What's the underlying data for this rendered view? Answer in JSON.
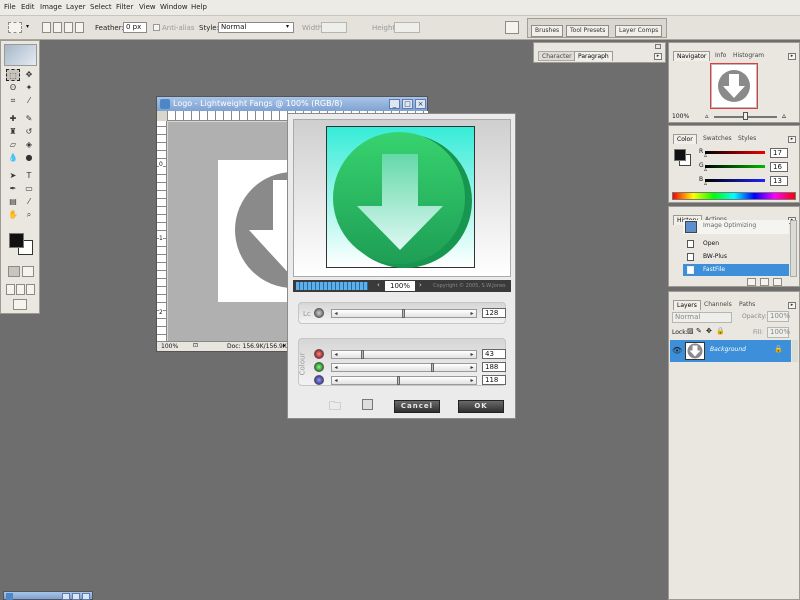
{
  "menu": [
    "File",
    "Edit",
    "Image",
    "Layer",
    "Select",
    "Filter",
    "View",
    "Window",
    "Help"
  ],
  "options": {
    "feather_label": "Feather:",
    "feather_value": "0 px",
    "antialias_label": "Anti-alias",
    "style_label": "Style:",
    "style_value": "Normal",
    "width_label": "Width:",
    "height_label": "Height:"
  },
  "well_tabs": [
    "Brushes",
    "Tool Presets",
    "Layer Comps"
  ],
  "char_panel": {
    "tabs": [
      "Character",
      "Paragraph"
    ]
  },
  "navigator": {
    "tabs": [
      "Navigator",
      "Info",
      "Histogram"
    ],
    "zoom": "100%"
  },
  "color": {
    "tabs": [
      "Color",
      "Swatches",
      "Styles"
    ],
    "r_label": "R",
    "g_label": "G",
    "b_label": "B",
    "r": "17",
    "g": "16",
    "b": "13"
  },
  "history": {
    "tabs": [
      "History",
      "Actions"
    ],
    "items": [
      "Image Optimizing",
      "Open",
      "BW-Plus",
      "FastFile"
    ]
  },
  "layers": {
    "tabs": [
      "Layers",
      "Channels",
      "Paths"
    ],
    "blend": "Normal",
    "opacity_label": "Opacity:",
    "opacity": "100%",
    "lock_label": "Lock:",
    "fill_label": "Fill:",
    "fill": "100%",
    "layer_name": "Background"
  },
  "document": {
    "title": "Logo - Lightweight Fangs @ 100% (RGB/8)",
    "zoom": "100%",
    "doc_size": "Doc: 156.9K/156.9K",
    "ruler": [
      "0",
      "1",
      "2"
    ]
  },
  "dialog": {
    "zoom": "100%",
    "copyright": "Copyright © 2005, S.W.Jones",
    "lc_label": "Lc",
    "lc_value": "128",
    "colour_label": "Colour",
    "r_value": "43",
    "g_value": "188",
    "b_value": "118",
    "cancel": "Cancel",
    "ok": "OK",
    "lc_level": 0.5,
    "r_level": 0.17,
    "g_level": 0.74,
    "b_level": 0.46
  },
  "colors": {
    "accent": "#3c8fd8",
    "dialog_green": "#2fbd70",
    "dialog_cyan": "#38e8d8"
  }
}
